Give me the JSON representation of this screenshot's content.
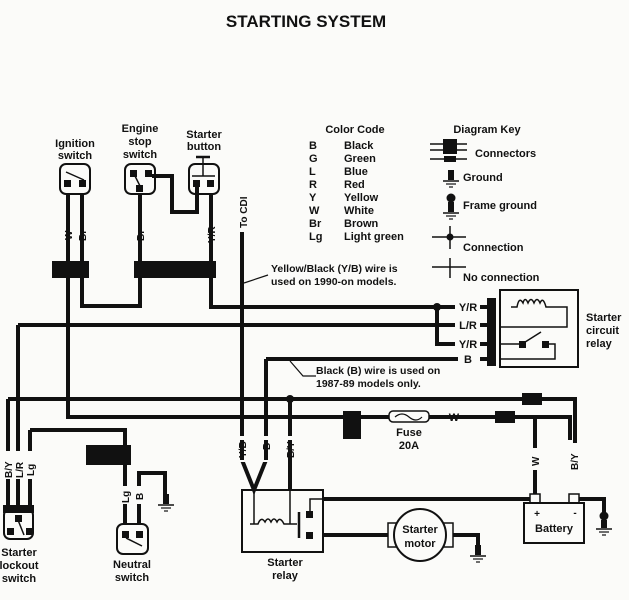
{
  "title": "STARTING SYSTEM",
  "color_code": {
    "heading": "Color Code",
    "entries": [
      {
        "code": "B",
        "name": "Black"
      },
      {
        "code": "G",
        "name": "Green"
      },
      {
        "code": "L",
        "name": "Blue"
      },
      {
        "code": "R",
        "name": "Red"
      },
      {
        "code": "Y",
        "name": "Yellow"
      },
      {
        "code": "W",
        "name": "White"
      },
      {
        "code": "Br",
        "name": "Brown"
      },
      {
        "code": "Lg",
        "name": "Light green"
      }
    ]
  },
  "diagram_key": {
    "heading": "Diagram Key",
    "items": [
      {
        "symbol": "connectors",
        "label": "Connectors"
      },
      {
        "symbol": "ground",
        "label": "Ground"
      },
      {
        "symbol": "frame-ground",
        "label": "Frame ground"
      },
      {
        "symbol": "connection",
        "label": "Connection"
      },
      {
        "symbol": "no-connection",
        "label": "No connection"
      }
    ]
  },
  "components": {
    "ignition_switch": [
      "Ignition",
      "switch"
    ],
    "engine_stop_switch": [
      "Engine",
      "stop",
      "switch"
    ],
    "starter_button": [
      "Starter",
      "button"
    ],
    "starter_circuit_relay": [
      "Starter",
      "circuit",
      "relay"
    ],
    "starter_lockout_switch": [
      "Starter",
      "lockout",
      "switch"
    ],
    "neutral_switch": [
      "Neutral",
      "switch"
    ],
    "starter_relay": [
      "Starter",
      "relay"
    ],
    "starter_motor": [
      "Starter",
      "motor"
    ],
    "battery": "Battery",
    "fuse": [
      "Fuse",
      "20A"
    ],
    "to_cdi": "To CDI"
  },
  "wire_labels": {
    "ign_w": "W",
    "ign_br": "Br",
    "stop_br": "Br",
    "btn_yr": "Y/R",
    "relay_yr1": "Y/R",
    "relay_lr": "L/R",
    "relay_yr2": "Y/R",
    "relay_b": "B",
    "lock_by": "B/Y",
    "lock_lr": "L/R",
    "lock_lg": "Lg",
    "neu_lg": "Lg",
    "neu_b": "B",
    "sr_yb": "Y/B",
    "sr_b": "B",
    "sr_by": "B/Y",
    "fuse_w": "W",
    "bat_w": "W",
    "bat_by": "B/Y",
    "bat_plus": "+",
    "bat_minus": "-"
  },
  "notes": {
    "yb_note": [
      "Yellow/Black (Y/B) wire is",
      "used on 1990-on models."
    ],
    "b_note": [
      "Black (B) wire is used on",
      "1987-89 models only."
    ]
  }
}
